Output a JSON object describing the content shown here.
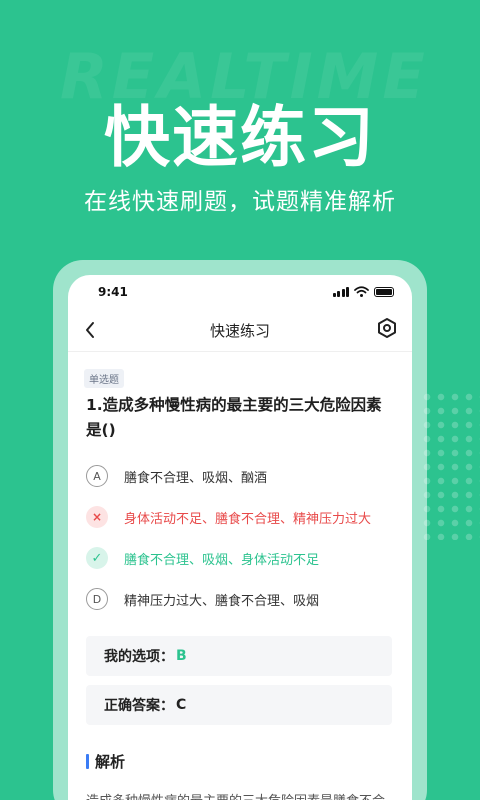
{
  "hero": {
    "watermark": "REALTIME",
    "title": "快速练习",
    "subtitle": "在线快速刷题，试题精准解析"
  },
  "status_bar": {
    "time": "9:41"
  },
  "nav": {
    "back_icon": "chevron-left-icon",
    "title": "快速练习",
    "settings_icon": "hexagon-settings-icon"
  },
  "question": {
    "type_tag": "单选题",
    "text": "1.造成多种慢性病的最主要的三大危险因素是()",
    "options": [
      {
        "mark": "A",
        "state": "normal",
        "text": "膳食不合理、吸烟、酗酒"
      },
      {
        "mark": "×",
        "state": "wrong",
        "text": "身体活动不足、膳食不合理、精神压力过大"
      },
      {
        "mark": "✓",
        "state": "correct",
        "text": "膳食不合理、吸烟、身体活动不足"
      },
      {
        "mark": "D",
        "state": "normal",
        "text": "精神压力过大、膳食不合理、吸烟"
      }
    ]
  },
  "my_answer": {
    "label": "我的选项：",
    "value": "B"
  },
  "correct_answer": {
    "label": "正确答案：",
    "value": "C"
  },
  "analysis": {
    "title": "解析",
    "text": "造成多种慢性病的最主要的三大危险因素是膳食不合"
  },
  "colors": {
    "brand": "#2cc38f",
    "wrong": "#e84a4a",
    "accent_bar": "#3a7cf5"
  }
}
